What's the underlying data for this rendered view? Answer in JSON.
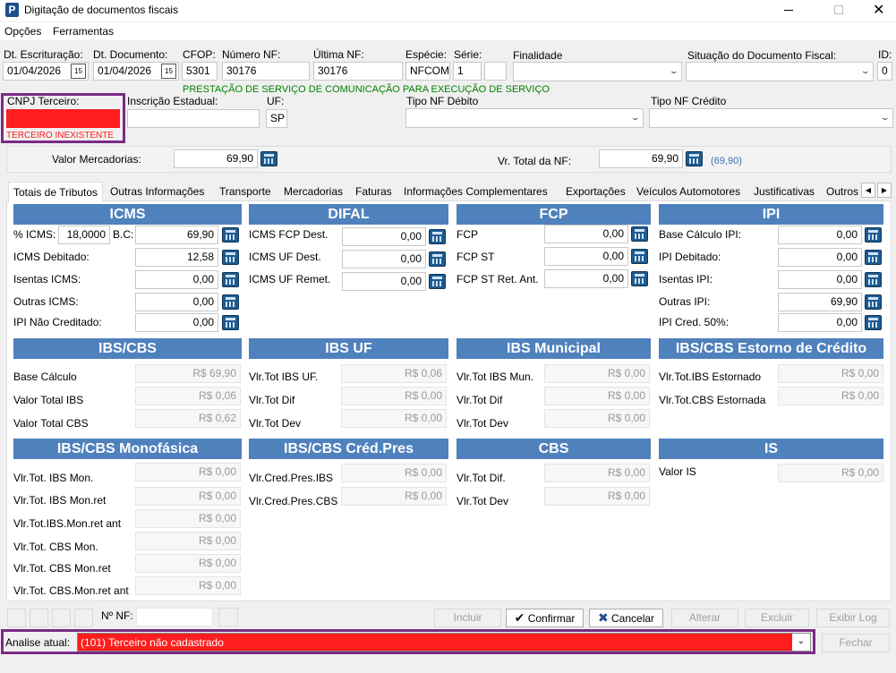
{
  "window": {
    "title": "Digitação de documentos fiscais",
    "app_icon": "P"
  },
  "menu": [
    "Opções",
    "Ferramentas"
  ],
  "header": {
    "dt_escrituracao": {
      "label": "Dt. Escrituração:",
      "value": "01/04/2026"
    },
    "dt_documento": {
      "label": "Dt. Documento:",
      "value": "01/04/2026"
    },
    "cfop": {
      "label": "CFOP:",
      "value": "5301"
    },
    "numero_nf": {
      "label": "Número NF:",
      "value": "30176"
    },
    "ultima_nf": {
      "label": "Última NF:",
      "value": "30176"
    },
    "especie": {
      "label": "Espécie:",
      "value": "NFCOM"
    },
    "serie": {
      "label": "Série:",
      "value": "1"
    },
    "finalidade": {
      "label": "Finalidade",
      "value": ""
    },
    "situacao": {
      "label": "Situação do Documento Fiscal:",
      "value": ""
    },
    "id": {
      "label": "ID:",
      "value": "0"
    },
    "cfop_desc": "PRESTAÇÃO DE SERVIÇO DE COMUNICAÇÃO PARA EXECUÇÃO DE SERVIÇO",
    "cnpj": {
      "label": "CNPJ Terceiro:",
      "value": "",
      "error": "TERCEIRO INEXISTENTE"
    },
    "ie": {
      "label": "Inscrição Estadual:",
      "value": ""
    },
    "uf": {
      "label": "UF:",
      "value": "SP"
    },
    "tipo_nf_debito": {
      "label": "Tipo NF Débito",
      "value": ""
    },
    "tipo_nf_credito": {
      "label": "Tipo NF Crédito",
      "value": ""
    }
  },
  "totals": {
    "valor_mercadorias": {
      "label": "Valor Mercadorias:",
      "value": "69,90"
    },
    "vr_total_nf": {
      "label": "Vr. Total da NF:",
      "value": "69,90",
      "hint": "(69,90)"
    }
  },
  "tabs": [
    "Totais de Tributos",
    "Outras Informações",
    "Transporte",
    "Mercadorias",
    "Faturas",
    "Informações Complementares",
    "Exportações",
    "Veículos Automotores",
    "Justificativas",
    "Outros"
  ],
  "sections": {
    "icms": {
      "title": "ICMS",
      "pct_label": "% ICMS:",
      "pct_value": "18,0000",
      "bc_label": "B.C:",
      "bc_value": "69,90",
      "rows": [
        {
          "label": "ICMS Debitado:",
          "value": "12,58"
        },
        {
          "label": "Isentas ICMS:",
          "value": "0,00"
        },
        {
          "label": "Outras ICMS:",
          "value": "0,00"
        },
        {
          "label": "IPI Não Creditado:",
          "value": "0,00"
        }
      ]
    },
    "difal": {
      "title": "DIFAL",
      "rows": [
        {
          "label": "ICMS FCP Dest.",
          "value": "0,00"
        },
        {
          "label": "ICMS UF Dest.",
          "value": "0,00"
        },
        {
          "label": "ICMS UF Remet.",
          "value": "0,00"
        }
      ]
    },
    "fcp": {
      "title": "FCP",
      "rows": [
        {
          "label": "FCP",
          "value": "0,00"
        },
        {
          "label": "FCP ST",
          "value": "0,00"
        },
        {
          "label": "FCP ST Ret. Ant.",
          "value": "0,00"
        }
      ]
    },
    "ipi": {
      "title": "IPI",
      "rows": [
        {
          "label": "Base Cálculo IPI:",
          "value": "0,00"
        },
        {
          "label": "IPI Debitado:",
          "value": "0,00"
        },
        {
          "label": "Isentas IPI:",
          "value": "0,00"
        },
        {
          "label": "Outras IPI:",
          "value": "69,90"
        },
        {
          "label": "IPI Cred. 50%:",
          "value": "0,00"
        }
      ]
    },
    "ibscbs": {
      "title": "IBS/CBS",
      "rows": [
        {
          "label": "Base Cálculo",
          "value": "R$ 69,90"
        },
        {
          "label": "Valor Total IBS",
          "value": "R$ 0,06"
        },
        {
          "label": "Valor Total CBS",
          "value": "R$ 0,62"
        }
      ]
    },
    "ibsuf": {
      "title": "IBS UF",
      "rows": [
        {
          "label": "Vlr.Tot IBS UF.",
          "value": "R$ 0,06"
        },
        {
          "label": "Vlr.Tot Dif",
          "value": "R$ 0,00"
        },
        {
          "label": "Vlr.Tot Dev",
          "value": "R$ 0,00"
        }
      ]
    },
    "ibsmun": {
      "title": "IBS Municipal",
      "rows": [
        {
          "label": "Vlr.Tot IBS Mun.",
          "value": "R$ 0,00"
        },
        {
          "label": "Vlr.Tot Dif",
          "value": "R$ 0,00"
        },
        {
          "label": "Vlr.Tot Dev",
          "value": "R$ 0,00"
        }
      ]
    },
    "estorno": {
      "title": "IBS/CBS Estorno de Crédito",
      "rows": [
        {
          "label": "Vlr.Tot.IBS Estornado",
          "value": "R$ 0,00"
        },
        {
          "label": "Vlr.Tot.CBS Estornada",
          "value": "R$ 0,00"
        }
      ]
    },
    "mono": {
      "title": "IBS/CBS Monofásica",
      "rows": [
        {
          "label": "Vlr.Tot. IBS Mon.",
          "value": "R$ 0,00"
        },
        {
          "label": "Vlr.Tot. IBS Mon.ret",
          "value": "R$ 0,00"
        },
        {
          "label": "Vlr.Tot.IBS.Mon.ret ant",
          "value": "R$ 0,00"
        },
        {
          "label": "Vlr.Tot. CBS Mon.",
          "value": "R$ 0,00"
        },
        {
          "label": "Vlr.Tot. CBS Mon.ret",
          "value": "R$ 0,00"
        },
        {
          "label": "Vlr.Tot. CBS.Mon.ret ant",
          "value": "R$ 0,00"
        }
      ]
    },
    "credpres": {
      "title": "IBS/CBS Créd.Pres",
      "rows": [
        {
          "label": "Vlr.Cred.Pres.IBS",
          "value": "R$ 0,00"
        },
        {
          "label": "Vlr.Cred.Pres.CBS",
          "value": "R$ 0,00"
        }
      ]
    },
    "cbs": {
      "title": "CBS",
      "rows": [
        {
          "label": "Vlr.Tot Dif.",
          "value": "R$ 0,00"
        },
        {
          "label": "Vlr.Tot Dev",
          "value": "R$ 0,00"
        }
      ]
    },
    "is": {
      "title": "IS",
      "rows": [
        {
          "label": "Valor IS",
          "value": "R$ 0,00"
        }
      ]
    }
  },
  "bottom": {
    "nf_label": "Nº NF:",
    "nf_value": "",
    "buttons": {
      "incluir": "Incluir",
      "confirmar": "Confirmar",
      "cancelar": "Cancelar",
      "alterar": "Alterar",
      "excluir": "Excluir",
      "exibir_log": "Exibir Log",
      "fechar": "Fechar"
    },
    "analise_label": "Analise atual:",
    "analise_value": "(101) Terceiro não cadastrado"
  },
  "colors": {
    "header_blue": "#4f81bd",
    "error_red": "#ff1d1d",
    "highlight_border": "#7b2a86",
    "green_text": "#008000"
  }
}
